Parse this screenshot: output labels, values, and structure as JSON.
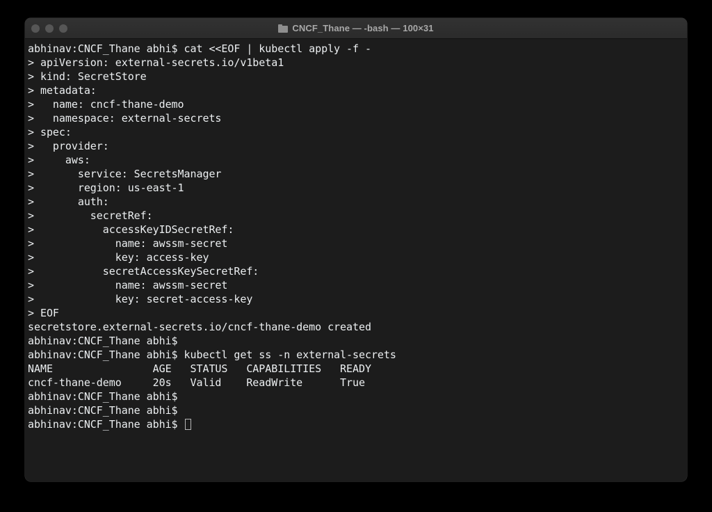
{
  "window": {
    "title": "CNCF_Thane — -bash — 100×31",
    "folder_icon": "folder-icon",
    "traffic_lights": [
      {
        "name": "close-button",
        "color": "#565656"
      },
      {
        "name": "minimize-button",
        "color": "#565656"
      },
      {
        "name": "zoom-button",
        "color": "#565656"
      }
    ],
    "titlebar_bg": "#2d2d2d",
    "body_bg": "#1c1c1c",
    "text_color": "#eceff1"
  },
  "terminal": {
    "prompt": "abhinav:CNCF_Thane abhi$",
    "continuation": ">",
    "cursor": "block-outline-cursor",
    "lines": [
      "abhinav:CNCF_Thane abhi$ cat <<EOF | kubectl apply -f -",
      "> apiVersion: external-secrets.io/v1beta1",
      "> kind: SecretStore",
      "> metadata:",
      ">   name: cncf-thane-demo",
      ">   namespace: external-secrets",
      "> spec:",
      ">   provider:",
      ">     aws:",
      ">       service: SecretsManager",
      ">       region: us-east-1",
      ">       auth:",
      ">         secretRef:",
      ">           accessKeyIDSecretRef:",
      ">             name: awssm-secret",
      ">             key: access-key",
      ">           secretAccessKeySecretRef:",
      ">             name: awssm-secret",
      ">             key: secret-access-key",
      "> EOF",
      "secretstore.external-secrets.io/cncf-thane-demo created",
      "abhinav:CNCF_Thane abhi$",
      "abhinav:CNCF_Thane abhi$ kubectl get ss -n external-secrets",
      "NAME                AGE   STATUS   CAPABILITIES   READY",
      "cncf-thane-demo     20s   Valid    ReadWrite      True",
      "abhinav:CNCF_Thane abhi$",
      "abhinav:CNCF_Thane abhi$"
    ],
    "last_line": "abhinav:CNCF_Thane abhi$ ",
    "table": {
      "headers": [
        "NAME",
        "AGE",
        "STATUS",
        "CAPABILITIES",
        "READY"
      ],
      "rows": [
        [
          "cncf-thane-demo",
          "20s",
          "Valid",
          "ReadWrite",
          "True"
        ]
      ]
    },
    "manifest": {
      "apiVersion": "external-secrets.io/v1beta1",
      "kind": "SecretStore",
      "metadata": {
        "name": "cncf-thane-demo",
        "namespace": "external-secrets"
      },
      "spec": {
        "provider": {
          "aws": {
            "service": "SecretsManager",
            "region": "us-east-1",
            "auth": {
              "secretRef": {
                "accessKeyIDSecretRef": {
                  "name": "awssm-secret",
                  "key": "access-key"
                },
                "secretAccessKeySecretRef": {
                  "name": "awssm-secret",
                  "key": "secret-access-key"
                }
              }
            }
          }
        }
      }
    },
    "command_1": "cat <<EOF | kubectl apply -f -",
    "command_2": "kubectl get ss -n external-secrets",
    "result_1": "secretstore.external-secrets.io/cncf-thane-demo created"
  }
}
